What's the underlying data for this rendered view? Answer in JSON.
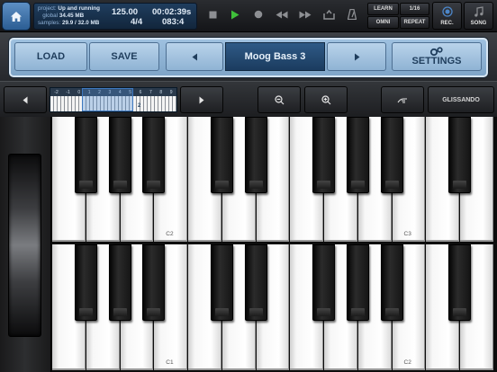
{
  "topbar": {
    "project_label": "project:",
    "project_value": "Up and running",
    "global_label": "global",
    "global_value": "34.45 MB",
    "samples_label": "samples:",
    "samples_value": "29.9 / 32.0 MB",
    "tempo": "125.00",
    "time": "00:02:39s",
    "signature": "4/4",
    "position": "083:4",
    "learn": "LEARN",
    "quantize": "1/16",
    "omni": "OMNI",
    "repeat": "REPEAT",
    "rec": "REC.",
    "song": "SONG"
  },
  "panel": {
    "load": "LOAD",
    "save": "SAVE",
    "preset_name": "Moog Bass 3",
    "settings": "SETTINGS"
  },
  "strip": {
    "glissando": "GLISSANDO",
    "minimap_numbers": [
      "-2",
      "-1",
      "0",
      "1",
      "2",
      "3",
      "4",
      "5",
      "6",
      "7",
      "8",
      "9"
    ],
    "octave_value": "2"
  },
  "keyboards": {
    "upper": {
      "labels": [
        "C2",
        "C3"
      ]
    },
    "lower": {
      "labels": [
        "C1",
        "C2"
      ]
    }
  },
  "colors": {
    "accent_blue": "#2b5d93",
    "panel_blue": "#9fc1e0",
    "play_green": "#3fbf3a"
  }
}
